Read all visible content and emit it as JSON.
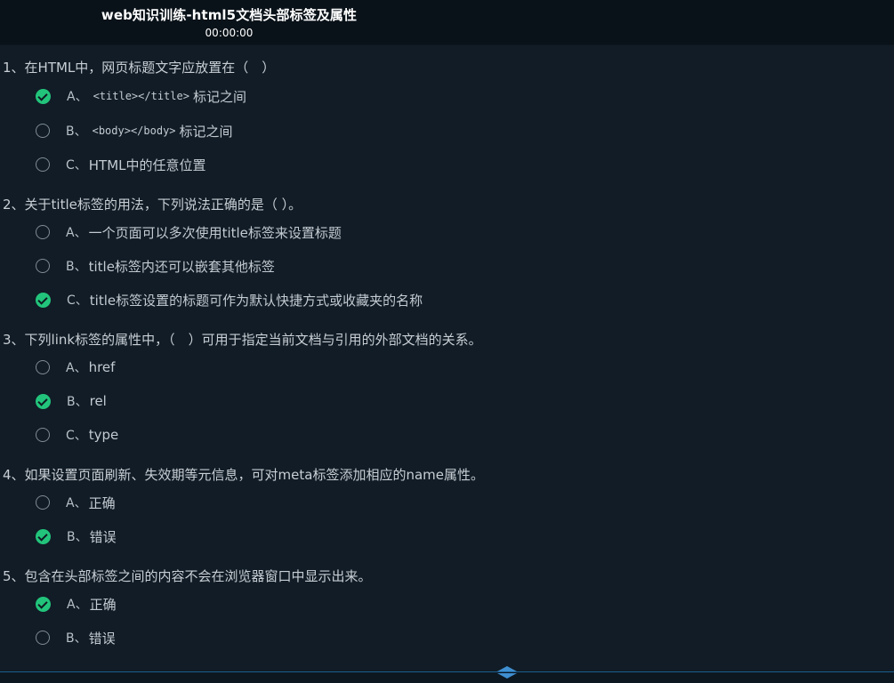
{
  "header": {
    "title": "web知识训练-html5文档头部标签及属性",
    "timer": "00:00:00"
  },
  "questions": [
    {
      "text": "1、在HTML中，网页标题文字应放置在（　）",
      "options": [
        {
          "letter": "A、",
          "code": "<title></title>",
          "text": "标记之间",
          "checked": true
        },
        {
          "letter": "B、",
          "code": "<body></body>",
          "text": "标记之间",
          "checked": false
        },
        {
          "letter": "C、",
          "code": "",
          "text": "HTML中的任意位置",
          "checked": false
        }
      ]
    },
    {
      "text": "2、关于title标签的用法，下列说法正确的是（ ）。",
      "options": [
        {
          "letter": "A、",
          "code": "",
          "text": "一个页面可以多次使用title标签来设置标题",
          "checked": false
        },
        {
          "letter": "B、",
          "code": "",
          "text": "title标签内还可以嵌套其他标签",
          "checked": false
        },
        {
          "letter": "C、",
          "code": "",
          "text": "title标签设置的标题可作为默认快捷方式或收藏夹的名称",
          "checked": true
        }
      ]
    },
    {
      "text": "3、下列link标签的属性中，（　）可用于指定当前文档与引用的外部文档的关系。",
      "options": [
        {
          "letter": "A、",
          "code": "",
          "text": "href",
          "checked": false
        },
        {
          "letter": "B、",
          "code": "",
          "text": "rel",
          "checked": true
        },
        {
          "letter": "C、",
          "code": "",
          "text": "type",
          "checked": false
        }
      ]
    },
    {
      "text": "4、如果设置页面刷新、失效期等元信息，可对meta标签添加相应的name属性。",
      "options": [
        {
          "letter": "A、",
          "code": "",
          "text": "正确",
          "checked": false
        },
        {
          "letter": "B、",
          "code": "",
          "text": "错误",
          "checked": true
        }
      ]
    },
    {
      "text": "5、包含在头部标签之间的内容不会在浏览器窗口中显示出来。",
      "options": [
        {
          "letter": "A、",
          "code": "",
          "text": "正确",
          "checked": true
        },
        {
          "letter": "B、",
          "code": "",
          "text": "错误",
          "checked": false
        }
      ]
    }
  ],
  "colors": {
    "background": "#111c26",
    "header": "#0a1219",
    "checked": "#22c47b",
    "footer_line": "#1c5d8e"
  },
  "icons": {
    "footer_toggle": "expand-collapse-icon"
  }
}
